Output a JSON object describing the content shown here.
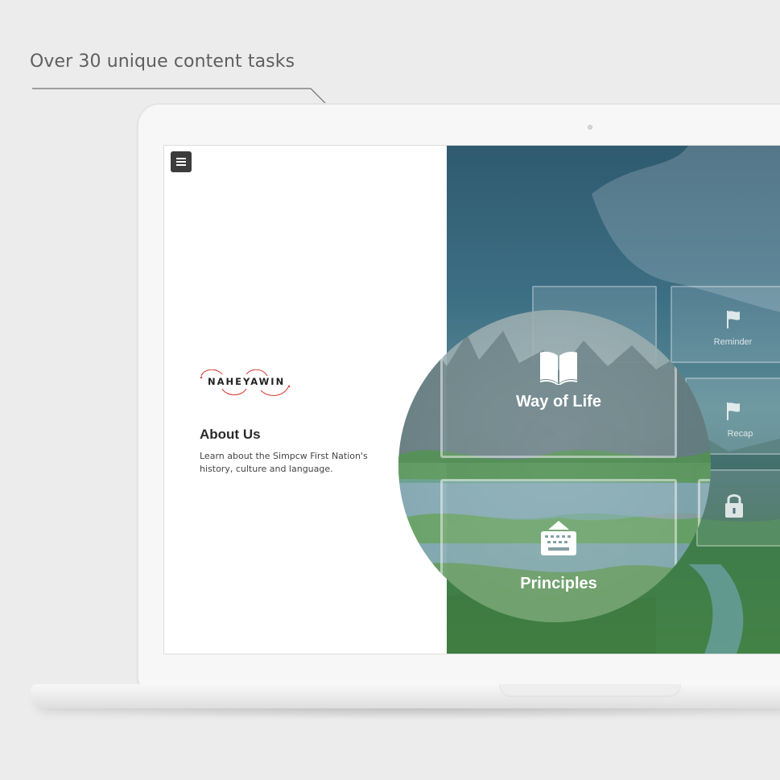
{
  "callout": {
    "text": "Over 30 unique content tasks"
  },
  "app": {
    "brand": "NAHEYAWIN",
    "about_title": "About Us",
    "about_description": "Learn about the Simpcw First Nation's history, culture and language."
  },
  "tiles": {
    "reminder": "Reminder",
    "recap": "Recap"
  },
  "magnified_tiles": {
    "way_of_life": "Way of Life",
    "principles": "Principles"
  },
  "icons": {
    "menu": "hamburger-menu-icon",
    "way_of_life": "open-book-icon",
    "principles": "keyboard-icon",
    "reminder": "flag-icon",
    "recap": "flag-icon",
    "locked": "padlock-icon"
  },
  "colors": {
    "brand_accent": "#d9342b",
    "menu_button": "#3c3c3c",
    "callout_text": "#5f5f5f"
  }
}
